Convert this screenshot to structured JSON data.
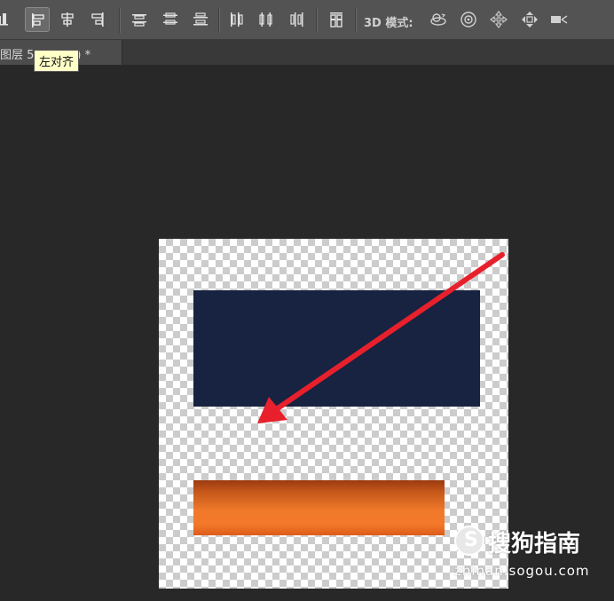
{
  "toolbar": {
    "mode_label": "3D 模式:",
    "icons": [
      "align-bottom-edges-icon",
      "align-left-edges-icon",
      "align-horizontal-centers-icon",
      "align-right-edges-icon",
      "distribute-top-icon",
      "distribute-vertical-centers-icon",
      "distribute-bottom-icon",
      "distribute-left-icon",
      "distribute-horizontal-centers-icon",
      "distribute-right-icon",
      "auto-align-layers-icon",
      "rotate-3d-icon",
      "roll-3d-icon",
      "drag-3d-icon",
      "slide-3d-icon",
      "scale-3d-icon"
    ],
    "active_tool": "align-left-edges-icon"
  },
  "tab": {
    "title": "图层 5",
    "title_suffix": ") *"
  },
  "tooltip": {
    "text": "左对齐"
  },
  "colors": {
    "navy": "#172340",
    "orange": "#f07a2a",
    "arrow": "#e8202c"
  },
  "watermark": {
    "logo_letter": "S",
    "brand": "搜狗指南",
    "url": "zhinan.sogou.com"
  }
}
